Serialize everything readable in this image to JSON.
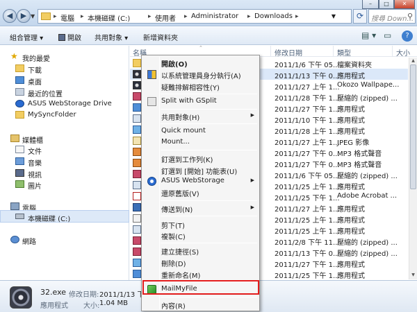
{
  "address": {
    "crumbs": [
      "電腦",
      "本機磁碟 (C:)",
      "使用者",
      "Administrator",
      "Downloads"
    ],
    "search_placeholder": "搜尋 Down..."
  },
  "window_controls": [
    "–",
    "□",
    "✕"
  ],
  "toolbar": {
    "organize": "組合管理 ▾",
    "open": "開啟",
    "share": "共用對象 ▾",
    "new_folder": "新增資料夾"
  },
  "nav": {
    "favorites": "我的最愛",
    "downloads": "下載",
    "desktop": "桌面",
    "recent": "最近的位置",
    "asus": "ASUS WebStorage Drive",
    "mysync": "MySyncFolder",
    "libraries": "媒體櫃",
    "documents": "文件",
    "music": "音樂",
    "videos": "視訊",
    "pictures": "圖片",
    "computer": "電腦",
    "local_disk": "本機磁碟 (C:)",
    "network": "網路"
  },
  "columns": {
    "name": "名稱",
    "date": "修改日期",
    "type": "類型",
    "size": "大小"
  },
  "rows": [
    {
      "date": "2011/1/6 下午 05...",
      "type": "檔案資料夾"
    },
    {
      "date": "2011/1/13 下午 0...",
      "type": "應用程式"
    },
    {
      "date": "2011/1/27 上午 1...",
      "type": "Okozo Wallpape..."
    },
    {
      "date": "2011/1/28 下午 1...",
      "type": "壓縮的 (zipped) ..."
    },
    {
      "date": "2011/1/27 下午 1...",
      "type": "應用程式"
    },
    {
      "date": "2011/1/10 下午 1...",
      "type": "應用程式"
    },
    {
      "date": "2011/1/28 上午 1...",
      "type": "應用程式"
    },
    {
      "date": "2011/1/27 上午 1...",
      "type": "JPEG 影像"
    },
    {
      "date": "2011/1/27 下午 0...",
      "type": "MP3 格式聲音"
    },
    {
      "date": "2011/1/27 下午 0...",
      "type": "MP3 格式聲音"
    },
    {
      "date": "2011/1/6 下午 05...",
      "type": "壓縮的 (zipped) ..."
    },
    {
      "date": "2011/1/25 上午 1...",
      "type": "應用程式"
    },
    {
      "date": "2011/1/25 下午 1...",
      "type": "Adobe Acrobat ..."
    },
    {
      "date": "2011/1/27 上午 1...",
      "type": "應用程式"
    },
    {
      "date": "2011/1/25 上午 1...",
      "type": "應用程式"
    },
    {
      "date": "2011/1/25 上午 1...",
      "type": "應用程式"
    },
    {
      "date": "2011/2/8 下午 11...",
      "type": "壓縮的 (zipped) ..."
    },
    {
      "date": "2011/1/13 下午 0...",
      "type": "壓縮的 (zipped) ..."
    },
    {
      "date": "2011/1/27 下午 1...",
      "type": "應用程式"
    },
    {
      "date": "2011/1/25 下午 1...",
      "type": "應用程式"
    },
    {
      "date": "2011/1/27 下午 0...",
      "type": "應用程式"
    },
    {
      "date": "2011/1/27 下午 0...",
      "type": "壓縮的 (zipped) ..."
    },
    {
      "date": "2011/1/28 上午 1...",
      "type": "壓縮的 (zipped) ..."
    }
  ],
  "row_fragment": "3",
  "context_menu": {
    "open": "開啟(O)",
    "run_as_admin": "以系統管理員身分執行(A)",
    "troubleshoot": "疑難排解相容性(Y)",
    "split": "Split with GSplit",
    "share": "共用對象(H)",
    "quick_mount": "Quick mount",
    "mount": "Mount...",
    "pin_taskbar": "釘選到工作列(K)",
    "pin_start": "釘選到 [開始] 功能表(U)",
    "asus": "ASUS WebStorage",
    "restore": "還原舊版(V)",
    "send_to": "傳送到(N)",
    "cut": "剪下(T)",
    "copy": "複製(C)",
    "shortcut": "建立捷徑(S)",
    "delete": "刪除(D)",
    "rename": "重新命名(M)",
    "mailmyfile": "MailMyFile",
    "properties": "內容(R)"
  },
  "details": {
    "filename": "32.exe",
    "modified_label": "修改日期:",
    "modified_value": "2011/1/13 下午",
    "type": "應用程式",
    "size_label": "大小:",
    "size_value": "1.04 MB"
  }
}
